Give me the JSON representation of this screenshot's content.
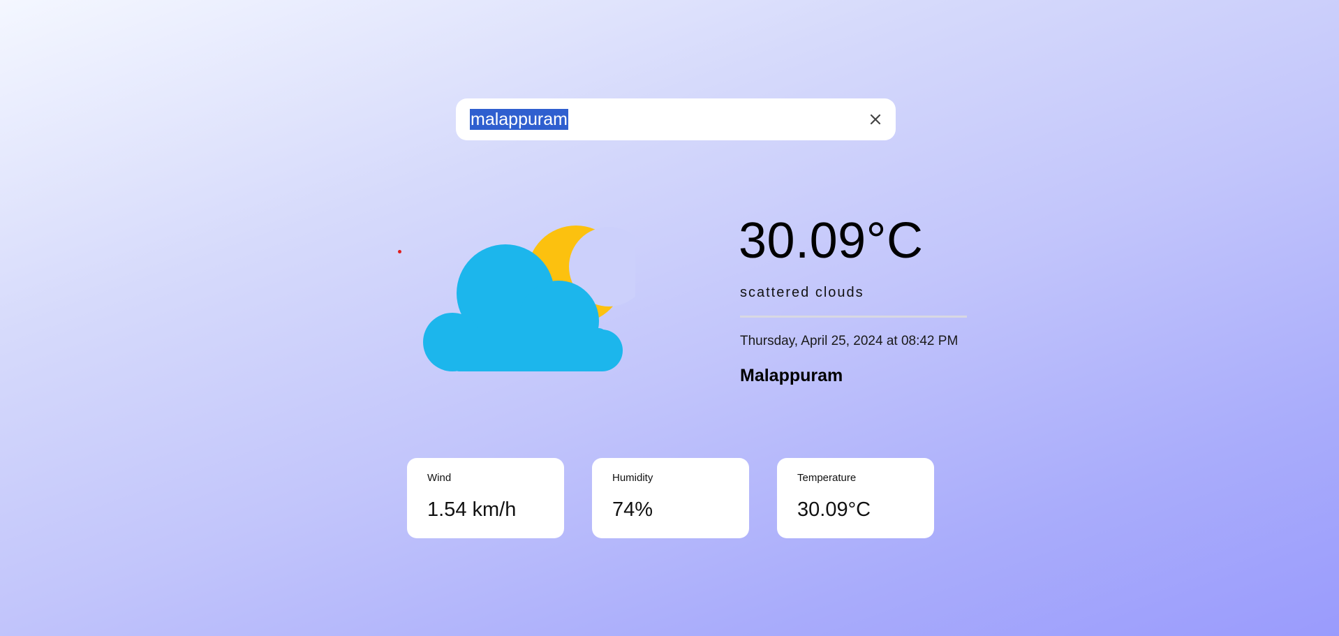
{
  "search": {
    "value": "malappuram",
    "clear_icon": "close-icon"
  },
  "weather": {
    "icon": "cloud-moon-icon",
    "temperature": "30.09°C",
    "description": "scattered clouds",
    "datetime": "Thursday, April 25, 2024 at 08:42 PM",
    "city": "Malappuram"
  },
  "stats": [
    {
      "label": "Wind",
      "value": "1.54 km/h"
    },
    {
      "label": "Humidity",
      "value": "74%"
    },
    {
      "label": "Temperature",
      "value": "30.09°C"
    }
  ],
  "colors": {
    "cloud": "#1cb6ec",
    "moon": "#fcc10f",
    "selection": "#2f5fcf"
  }
}
